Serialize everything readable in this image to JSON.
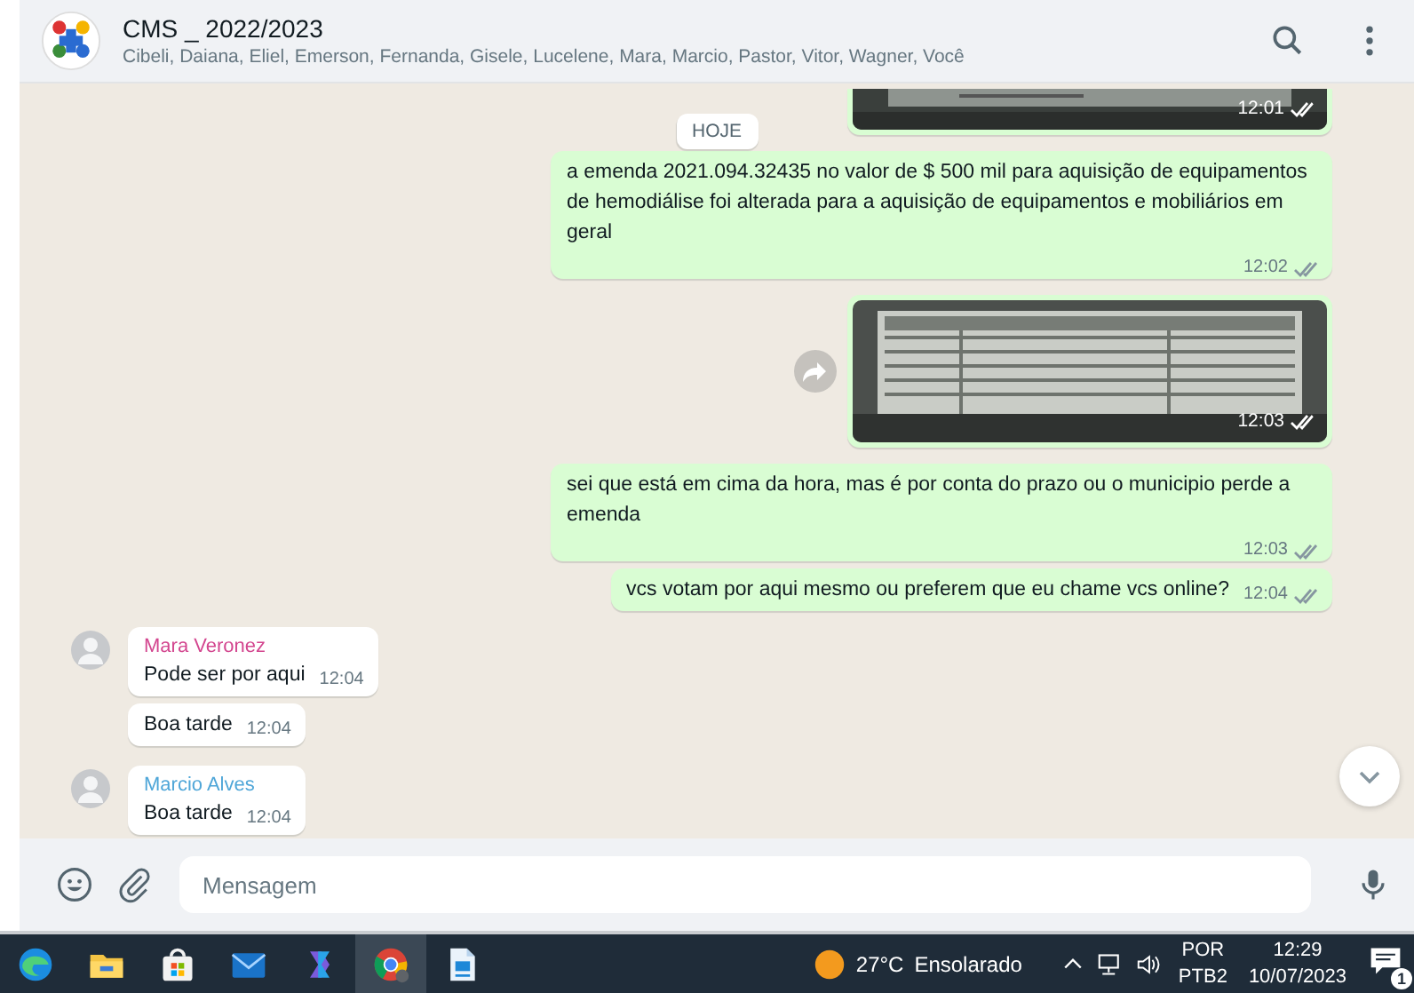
{
  "header": {
    "title": "CMS _ 2022/2023",
    "participants": "Cibeli, Daiana, Eliel, Emerson, Fernanda, Gisele, Lucelene, Mara, Marcio, Pastor, Vitor, Wagner, Você"
  },
  "date_chip": "HOJE",
  "messages": [
    {
      "outgoing": true,
      "cropped_top": true,
      "time": "12:01",
      "read": false
    },
    {
      "kind": "text",
      "outgoing": true,
      "text": "a emenda 2021.094.32435 no valor de $ 500 mil para aquisição de equipamentos de hemodiálise foi alterada para a aquisição de equipamentos e mobiliários em geral",
      "time": "12:02",
      "read": false
    },
    {
      "outgoing": true,
      "forward": true,
      "time": "12:03",
      "read": false
    },
    {
      "kind": "text",
      "outgoing": true,
      "text": "sei que está em cima da hora, mas é por conta do prazo ou o municipio perde a emenda",
      "time": "12:03",
      "read": false
    },
    {
      "kind": "text",
      "outgoing": true,
      "text": "vcs votam por aqui mesmo ou preferem que eu chame vcs online?",
      "time": "12:04",
      "read": false
    },
    {
      "kind": "text",
      "outgoing": false,
      "sender": "Mara Veronez",
      "color": "#d3468f",
      "text": "Pode ser por aqui",
      "time": "12:04"
    },
    {
      "kind": "text",
      "outgoing": false,
      "text": "Boa tarde",
      "time": "12:04"
    },
    {
      "kind": "text",
      "outgoing": false,
      "sender": "Marcio Alves",
      "color": "#4fa6d8",
      "text": "Boa tarde",
      "time": "12:04"
    }
  ],
  "composer": {
    "placeholder": "Mensagem"
  },
  "taskbar": {
    "apps": [
      {
        "kind": "edge",
        "active": false
      },
      {
        "kind": "folder",
        "active": false
      },
      {
        "kind": "store",
        "active": false
      },
      {
        "kind": "mail",
        "active": false
      },
      {
        "kind": "copilot",
        "active": false
      },
      {
        "kind": "chrome",
        "active": true
      },
      {
        "kind": "writer",
        "active": false
      }
    ],
    "weather": {
      "temperature": "27°C",
      "condition": "Ensolarado"
    },
    "language": "POR",
    "layout": "PTB2",
    "time": "12:29",
    "date": "10/07/2023",
    "notifications": "1"
  }
}
